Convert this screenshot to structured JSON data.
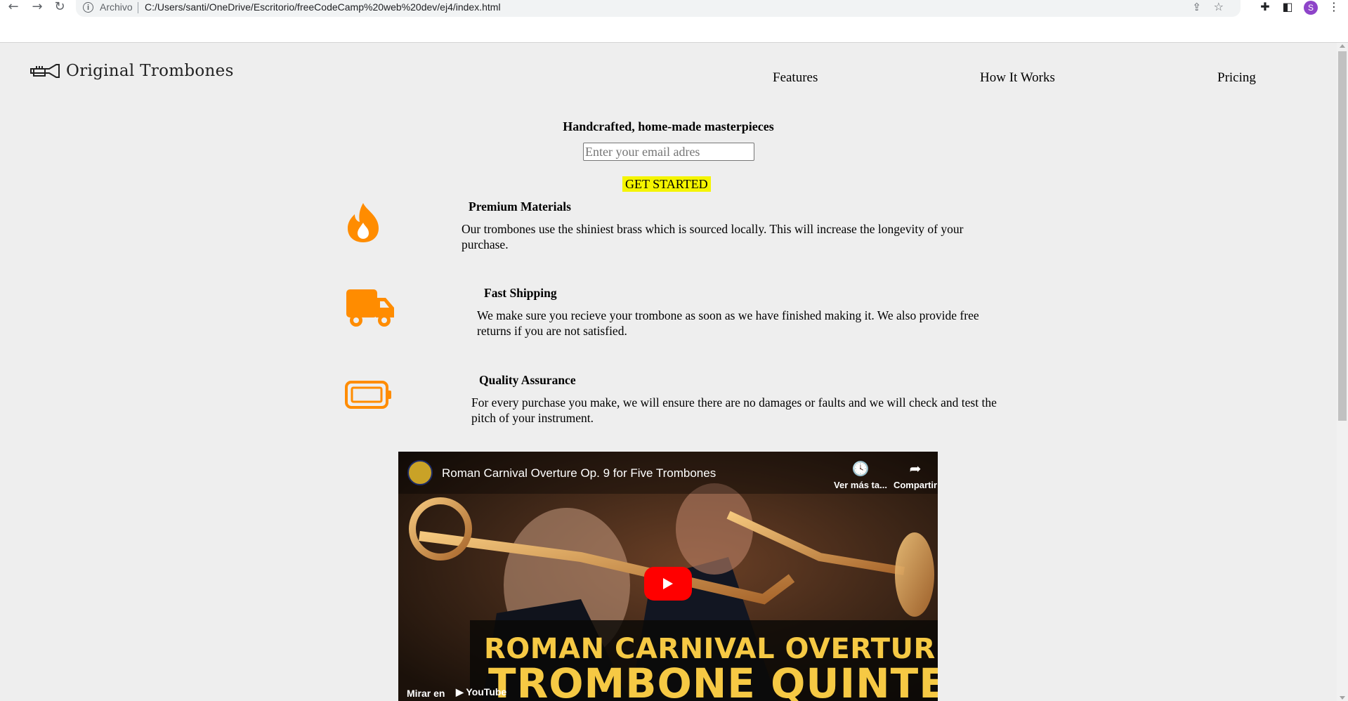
{
  "browser": {
    "scheme_label": "Archivo",
    "url": "C:/Users/santi/OneDrive/Escritorio/freeCodeCamp%20web%20dev/ej4/index.html",
    "profile_initial": "S"
  },
  "header": {
    "logo_text": "Original Trombones",
    "nav": [
      "Features",
      "How It Works",
      "Pricing"
    ]
  },
  "hero": {
    "title": "Handcrafted, home-made masterpieces",
    "email_placeholder": "Enter your email adres",
    "cta_label": "GET STARTED"
  },
  "features": [
    {
      "icon": "fire-icon",
      "title": "Premium Materials",
      "description": "Our trombones use the shiniest brass which is sourced locally. This will increase the longevity of your purchase."
    },
    {
      "icon": "truck-icon",
      "title": "Fast Shipping",
      "description": "We make sure you recieve your trombone as soon as we have finished making it. We also provide free returns if you are not satisfied."
    },
    {
      "icon": "battery-icon",
      "title": "Quality Assurance",
      "description": "For every purchase you make, we will ensure there are no damages or faults and we will check and test the pitch of your instrument."
    }
  ],
  "video": {
    "title": "Roman Carnival Overture Op. 9 for Five Trombones",
    "watch_later": "Ver más ta...",
    "share": "Compartir",
    "banner_line1": "ROMAN CARNIVAL OVERTURE",
    "banner_line2": "TROMBONE QUINTET",
    "watch_on": "Mirar en",
    "youtube": "YouTube"
  },
  "colors": {
    "accent": "#ff8c00",
    "cta": "#f5f500",
    "page_bg": "#eeeeee"
  }
}
